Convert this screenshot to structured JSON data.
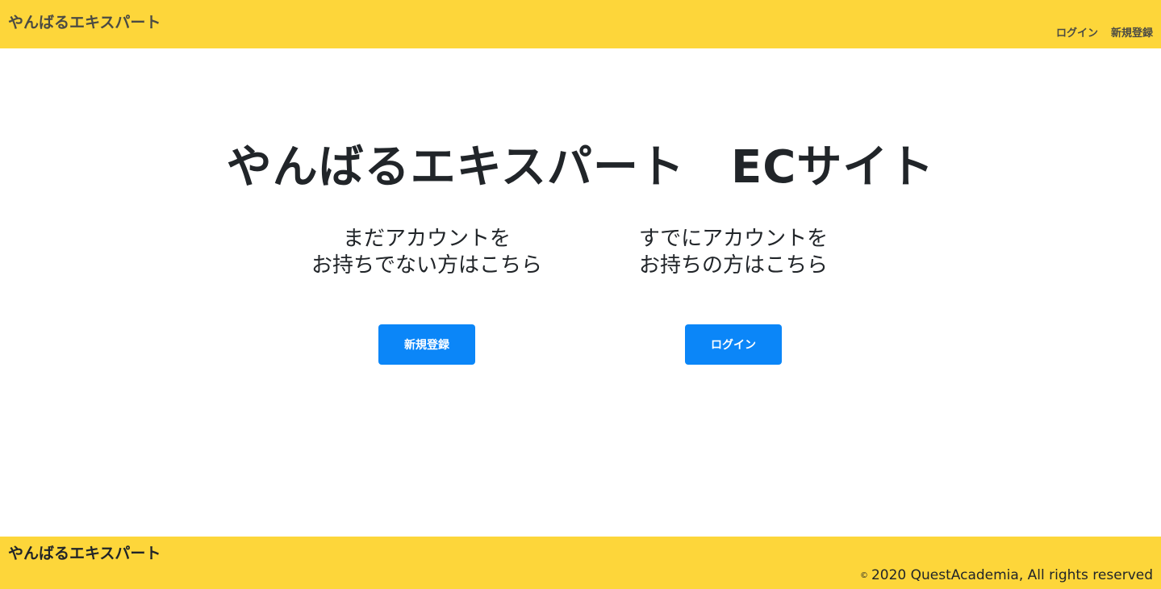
{
  "header": {
    "brand": "やんばるエキスパート",
    "nav": {
      "login": "ログイン",
      "signup": "新規登録"
    }
  },
  "main": {
    "title": "やんばるエキスパート　ECサイト",
    "left": {
      "line1": "まだアカウントを",
      "line2": "お持ちでない方はこちら",
      "button": "新規登録"
    },
    "right": {
      "line1": "すでにアカウントを",
      "line2": "お持ちの方はこちら",
      "button": "ログイン"
    }
  },
  "footer": {
    "brand": "やんばるエキスパート",
    "copyright_symbol": "©",
    "copyright_text": "2020 QuestAcademia, All rights reserved"
  },
  "colors": {
    "header_bg": "#fdd63a",
    "button_bg": "#0b86f8"
  }
}
